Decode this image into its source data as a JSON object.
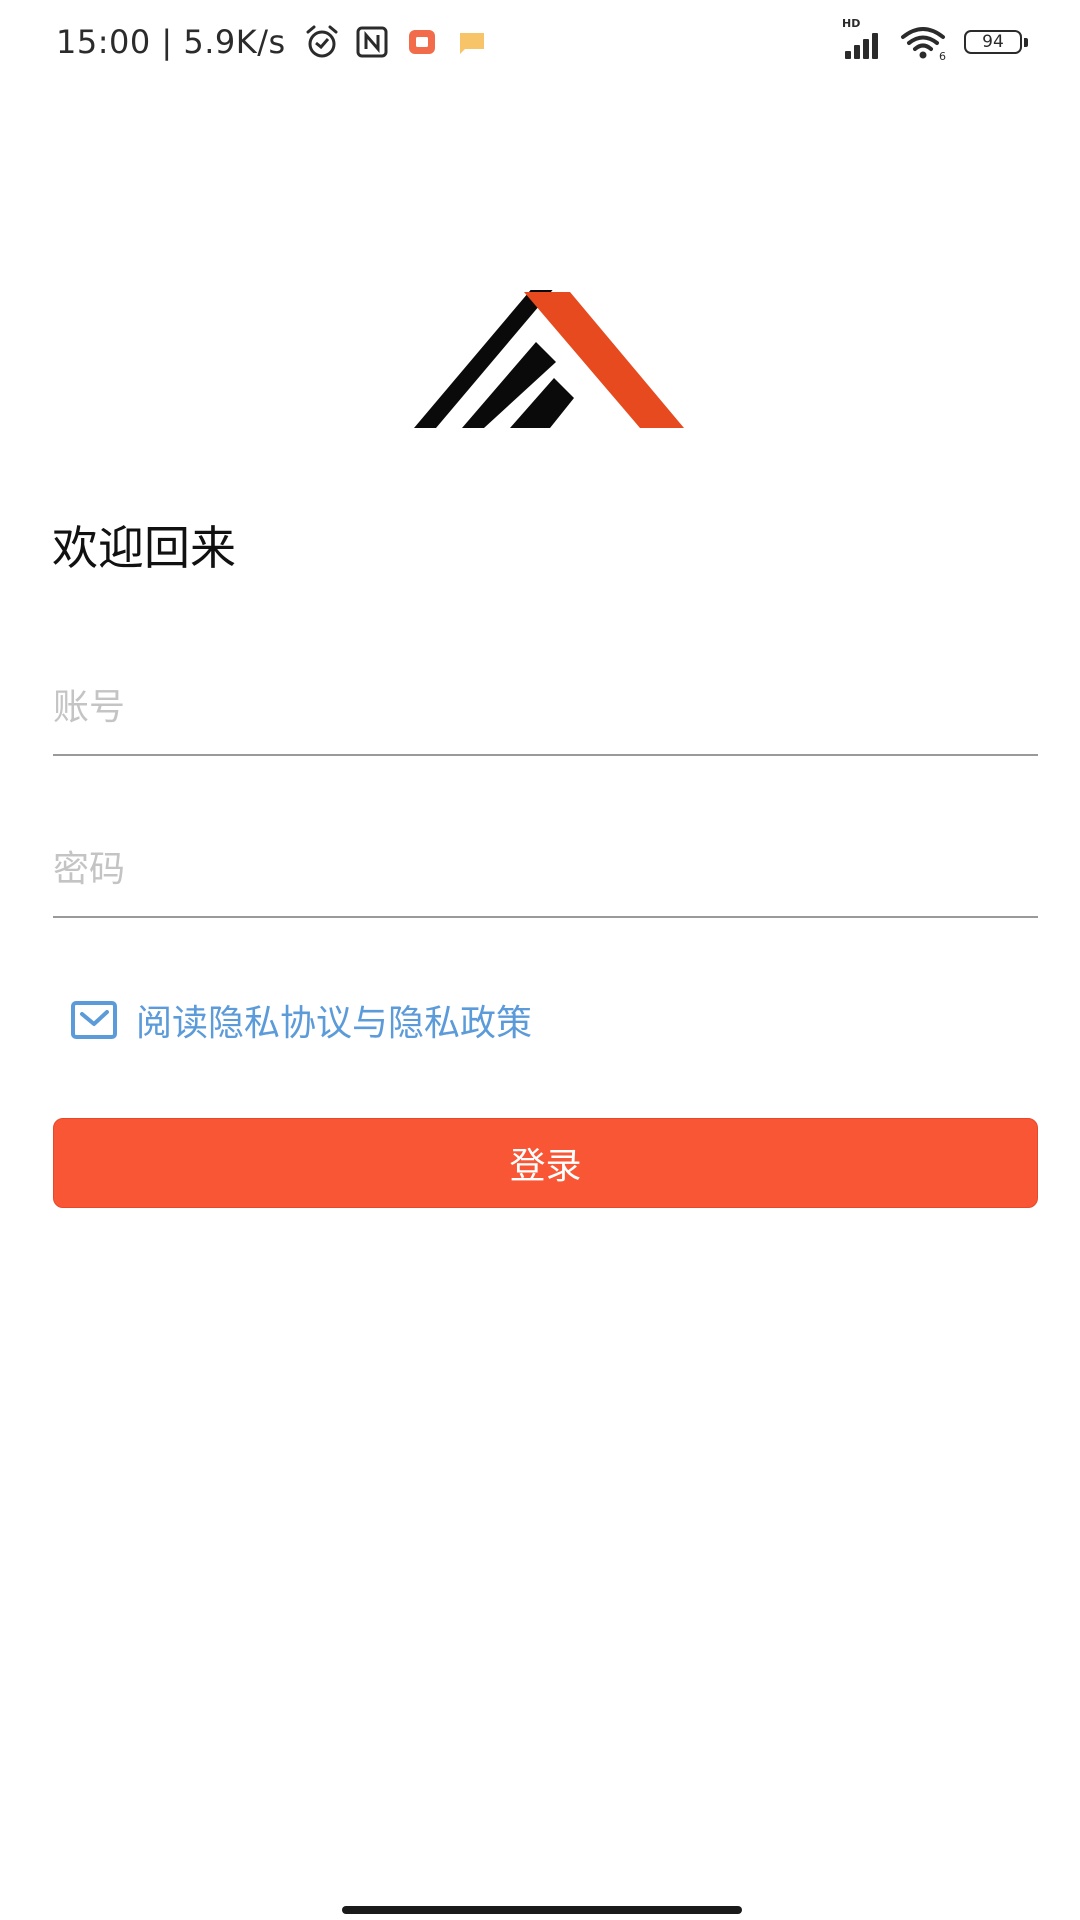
{
  "status_bar": {
    "time_speed": "15:00 | 5.9K/s",
    "hd_label": "HD",
    "wifi_label": "6",
    "battery": "94",
    "icons": [
      "alarm-icon",
      "nfc-icon",
      "app-notification-icon",
      "message-notification-icon",
      "signal-icon",
      "wifi-icon",
      "battery-icon"
    ]
  },
  "login": {
    "welcome": "欢迎回来",
    "account_placeholder": "账号",
    "password_placeholder": "密码",
    "agreement": "阅读隐私协议与隐私政策",
    "login_button": "登录"
  },
  "colors": {
    "accent": "#f95635",
    "logo_orange": "#e64a1e",
    "link_blue": "#5c9bd9"
  }
}
